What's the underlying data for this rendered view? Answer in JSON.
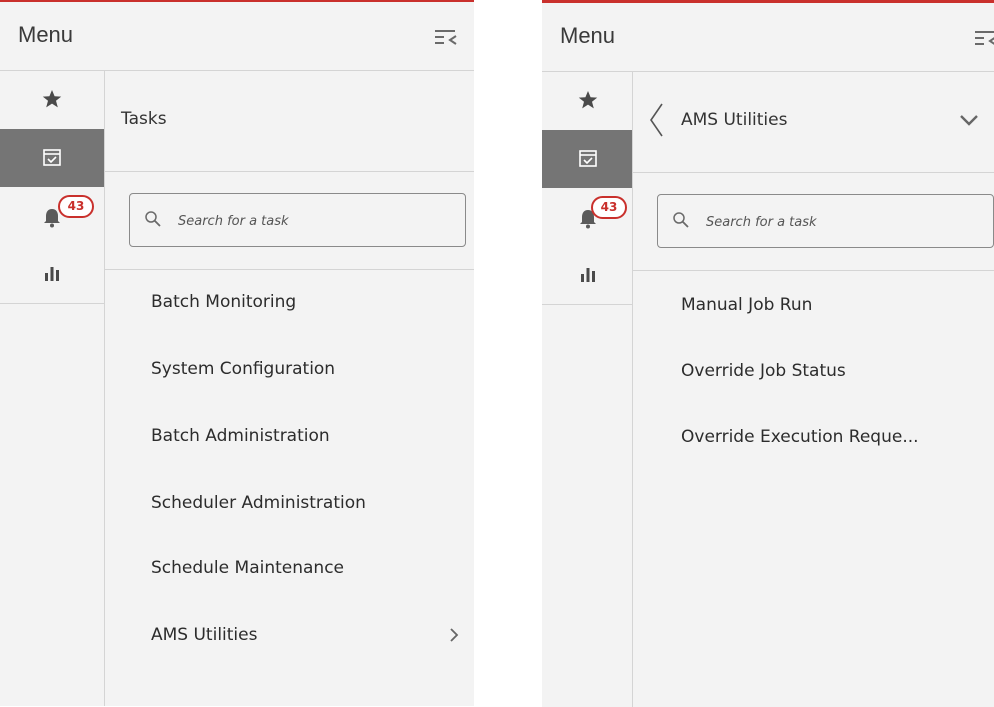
{
  "left_panel": {
    "menu_title": "Menu",
    "rail": {
      "notifications_count": "43"
    },
    "content_title": "Tasks",
    "search": {
      "placeholder": "Search for a task",
      "value": ""
    },
    "tasks": [
      {
        "label": "Batch Monitoring"
      },
      {
        "label": "System Configuration"
      },
      {
        "label": "Batch Administration"
      },
      {
        "label": "Scheduler Administration"
      },
      {
        "label": "Schedule Maintenance"
      },
      {
        "label": "AMS Utilities"
      }
    ]
  },
  "right_panel": {
    "menu_title": "Menu",
    "rail": {
      "notifications_count": "43"
    },
    "content_title": "AMS Utilities",
    "search": {
      "placeholder": "Search for a task",
      "value": ""
    },
    "tasks": [
      {
        "label": "Manual Job Run"
      },
      {
        "label": "Override Job Status"
      },
      {
        "label": "Override Execution Reque..."
      }
    ]
  },
  "icons": {
    "collapse": "collapse-menu-icon",
    "favorites": "star-icon",
    "tasks": "calendar-check-icon",
    "notifications": "bell-icon",
    "reports": "bar-chart-icon",
    "search": "search-icon",
    "submenu": "chevron-right-icon",
    "back": "chevron-left-icon",
    "expand": "chevron-down-icon"
  },
  "colors": {
    "accent": "#c9302c",
    "active_rail": "#757575",
    "panel_bg": "#f3f3f3",
    "divider": "#d4d4d4"
  }
}
